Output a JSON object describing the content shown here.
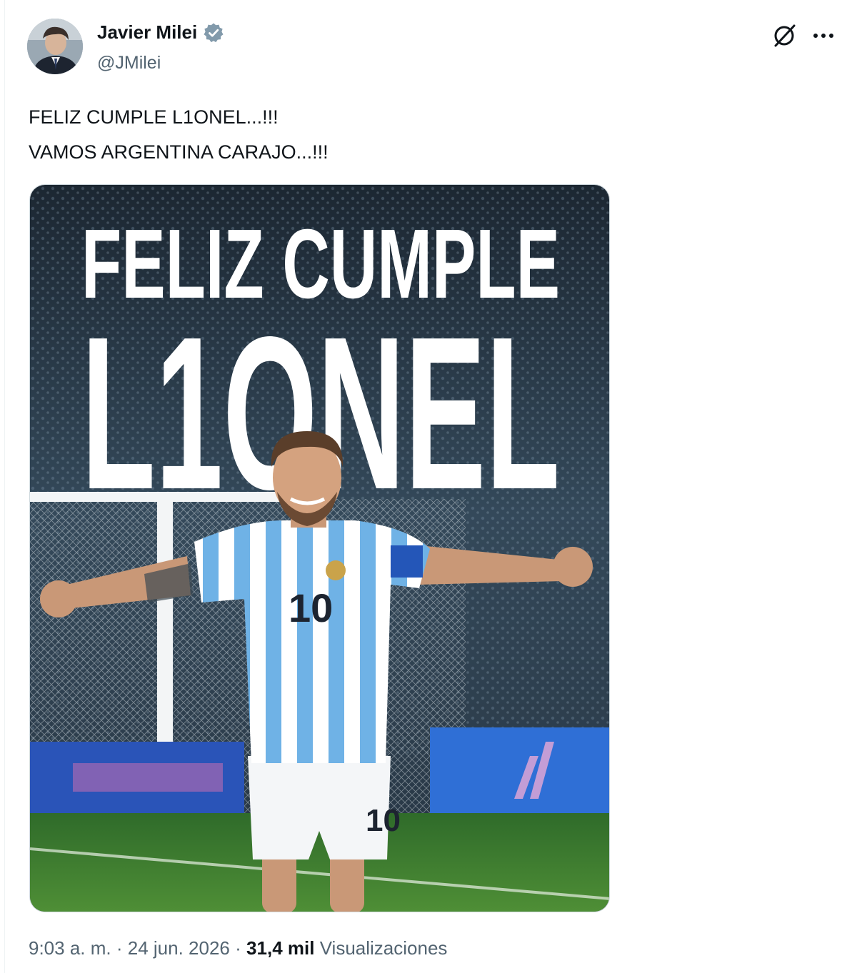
{
  "author": {
    "name": "Javier Milei",
    "handle": "@JMilei"
  },
  "tweet": {
    "lines": [
      "FELIZ CUMPLE L1ONEL...!!!",
      "VAMOS ARGENTINA CARAJO...!!!"
    ]
  },
  "media": {
    "headline": "FELIZ CUMPLE",
    "name_text": "L1ONEL",
    "jersey_number": "10"
  },
  "meta": {
    "time": "9:03 a. m.",
    "separator": "·",
    "date": "24 jun. 2026",
    "views_count": "31,4 mil",
    "views_label": "Visualizaciones"
  },
  "icons": {
    "verified": "verified-badge-icon",
    "grok": "grok-icon",
    "more": "more-options-icon"
  },
  "colors": {
    "verified_badge": "#829aab",
    "secondary_text": "#536471",
    "primary_text": "#0f1419",
    "jersey_blue": "#6fb2e6"
  }
}
